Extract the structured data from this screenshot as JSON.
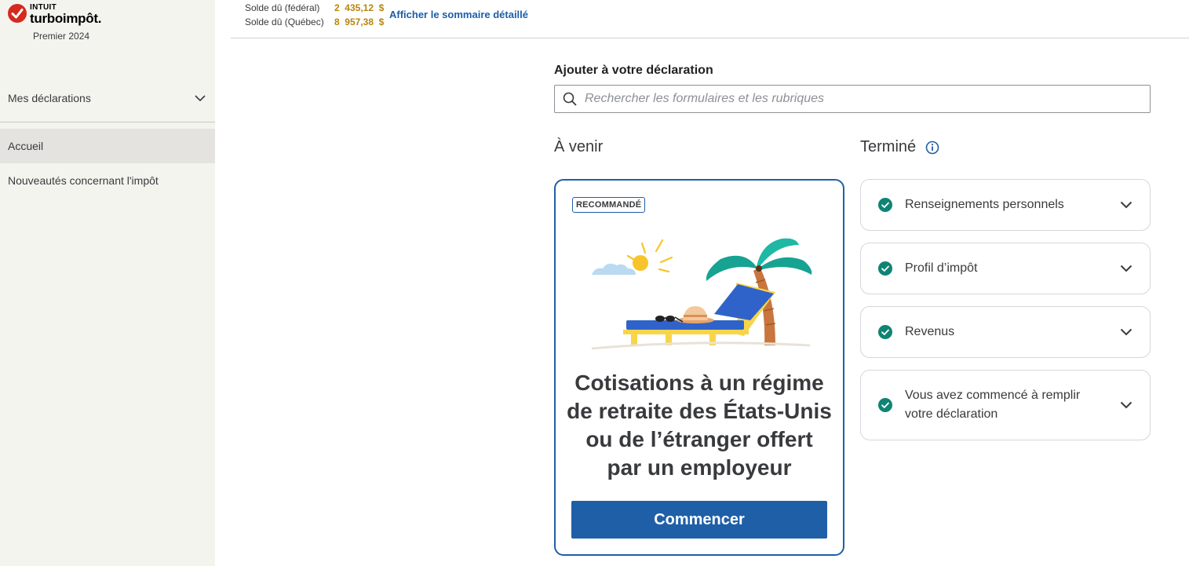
{
  "brand": {
    "company": "INTUIT",
    "product": "turboimpôt.",
    "edition": "Premier 2024",
    "accent": "#d52b1e"
  },
  "sidebar": {
    "returns_label": "Mes déclarations",
    "items": [
      {
        "label": "Accueil",
        "active": true
      },
      {
        "label": "Nouveautés concernant l'impôt",
        "active": false
      }
    ]
  },
  "header": {
    "balances": [
      {
        "label": "Solde dû (fédéral)",
        "amount": "2  435,12  $"
      },
      {
        "label": "Solde dû (Québec)",
        "amount": "8  957,38  $"
      }
    ],
    "summary_link": "Afficher le sommaire détaillé"
  },
  "search": {
    "label": "Ajouter à votre déclaration",
    "placeholder": "Rechercher les formulaires et les rubriques",
    "value": ""
  },
  "upcoming": {
    "title": "À venir",
    "badge": "RECOMMANDÉ",
    "card_title": "Cotisations à un régime de retraite des États-Unis ou de l’étranger offert par un employeur",
    "button": "Commencer"
  },
  "done": {
    "title": "Terminé",
    "items": [
      {
        "label": "Renseignements personnels"
      },
      {
        "label": "Profil d’impôt"
      },
      {
        "label": "Revenus"
      },
      {
        "label": "Vous avez commencé à remplir votre déclaration"
      }
    ]
  },
  "colors": {
    "primary": "#1f5fa8",
    "check": "#108474",
    "balance": "#b8860b",
    "sidebar_bg": "#f4f4ef"
  }
}
